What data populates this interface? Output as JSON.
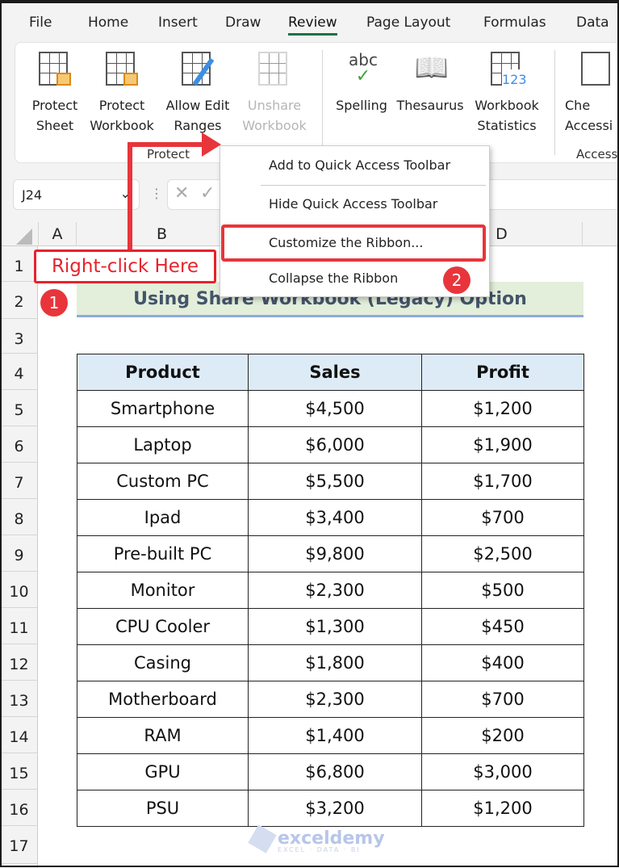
{
  "tabs": [
    "File",
    "Home",
    "Insert",
    "Draw",
    "Review",
    "Page Layout",
    "Formulas",
    "Data"
  ],
  "active_tab": "Review",
  "ribbon": {
    "buttons": [
      {
        "l1": "Protect",
        "l2": "Sheet",
        "icon": "protect-sheet-icon"
      },
      {
        "l1": "Protect",
        "l2": "Workbook",
        "icon": "protect-workbook-icon"
      },
      {
        "l1": "Allow Edit",
        "l2": "Ranges",
        "icon": "allow-edit-ranges-icon"
      },
      {
        "l1": "Unshare",
        "l2": "Workbook",
        "icon": "unshare-workbook-icon",
        "disabled": true
      },
      {
        "l1": "Spelling",
        "l2": "",
        "icon": "spelling-icon"
      },
      {
        "l1": "Thesaurus",
        "l2": "",
        "icon": "thesaurus-icon"
      },
      {
        "l1": "Workbook",
        "l2": "Statistics",
        "icon": "workbook-statistics-icon"
      },
      {
        "l1": "Che",
        "l2": "Accessi",
        "icon": "check-accessibility-icon"
      }
    ],
    "groups": {
      "protect": "Protect",
      "access": "Access"
    },
    "spelling_glyph": "abc",
    "stats_glyph": "123"
  },
  "name_box": "J24",
  "columns": [
    "A",
    "B",
    "C",
    "D"
  ],
  "rows": [
    "1",
    "2",
    "3",
    "4",
    "5",
    "6",
    "7",
    "8",
    "9",
    "10",
    "11",
    "12",
    "13",
    "14",
    "15",
    "16",
    "17"
  ],
  "sheet_title": "Using Share Workbook (Legacy) Option",
  "table": {
    "headers": [
      "Product",
      "Sales",
      "Profit"
    ],
    "rows": [
      [
        "Smartphone",
        "$4,500",
        "$1,200"
      ],
      [
        "Laptop",
        "$6,000",
        "$1,900"
      ],
      [
        "Custom PC",
        "$5,500",
        "$1,700"
      ],
      [
        "Ipad",
        "$3,400",
        "$700"
      ],
      [
        "Pre-built PC",
        "$9,800",
        "$2,500"
      ],
      [
        "Monitor",
        "$2,300",
        "$500"
      ],
      [
        "CPU Cooler",
        "$1,300",
        "$450"
      ],
      [
        "Casing",
        "$1,800",
        "$400"
      ],
      [
        "Motherboard",
        "$2,300",
        "$700"
      ],
      [
        "RAM",
        "$1,400",
        "$200"
      ],
      [
        "GPU",
        "$6,800",
        "$3,000"
      ],
      [
        "PSU",
        "$3,200",
        "$1,200"
      ]
    ]
  },
  "context_menu": {
    "items": [
      "Add to Quick Access Toolbar",
      "Hide Quick Access Toolbar",
      "Customize the Ribbon...",
      "Collapse the Ribbon"
    ]
  },
  "annotations": {
    "callout": "Right-click Here",
    "step1": "1",
    "step2": "2",
    "accent": "#e8353b"
  },
  "watermark": {
    "name": "exceldemy",
    "tagline": "EXCEL · DATA · BI"
  }
}
